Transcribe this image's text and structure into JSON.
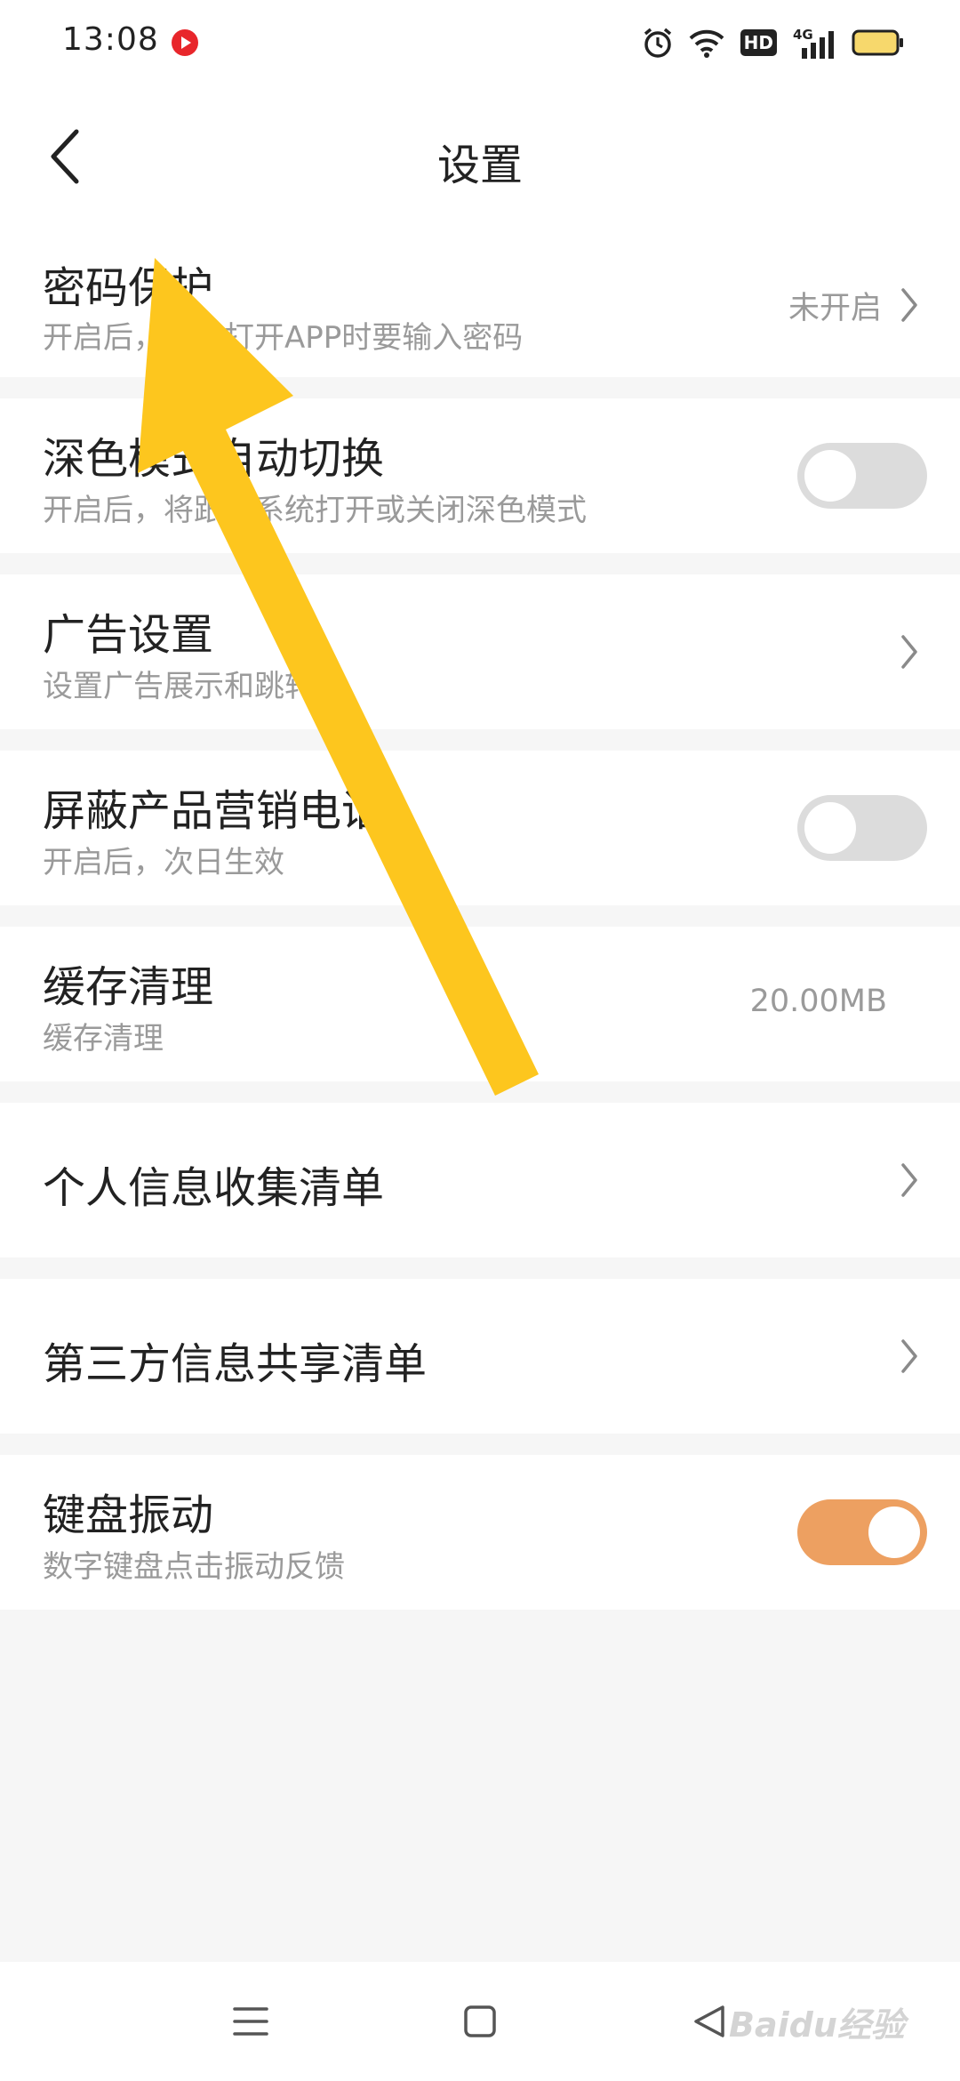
{
  "status_bar": {
    "time": "13:08",
    "icons": [
      "alarm-icon",
      "wifi-icon",
      "hd-icon",
      "signal-4g-icon",
      "battery-icon"
    ],
    "network_label": "4G",
    "hd_label": "HD"
  },
  "header": {
    "title": "设置"
  },
  "settings": {
    "password": {
      "title": "密码保护",
      "subtitle": "开启后，再次打开APP时要输入密码",
      "value": "未开启"
    },
    "dark_mode": {
      "title": "深色模式自动切换",
      "subtitle": "开启后，将跟随系统打开或关闭深色模式",
      "enabled": false
    },
    "ads": {
      "title": "广告设置",
      "subtitle": "设置广告展示和跳转"
    },
    "block_calls": {
      "title": "屏蔽产品营销电话",
      "subtitle": "开启后，次日生效",
      "enabled": false
    },
    "cache": {
      "title": "缓存清理",
      "subtitle": "缓存清理",
      "value": "20.00MB"
    },
    "personal_info": {
      "title": "个人信息收集清单"
    },
    "third_party": {
      "title": "第三方信息共享清单"
    },
    "keyboard_vibration": {
      "title": "键盘振动",
      "subtitle": "数字键盘点击振动反馈",
      "enabled": true
    }
  },
  "nav": {
    "icons": [
      "menu-icon",
      "home-square-icon",
      "back-triangle-icon"
    ]
  },
  "watermark": {
    "text": "Baidu经验"
  },
  "colors": {
    "toggle_on": "#eda061",
    "toggle_off": "#dcdcdc",
    "arrow": "#fdc61e",
    "background": "#f6f6f6"
  }
}
